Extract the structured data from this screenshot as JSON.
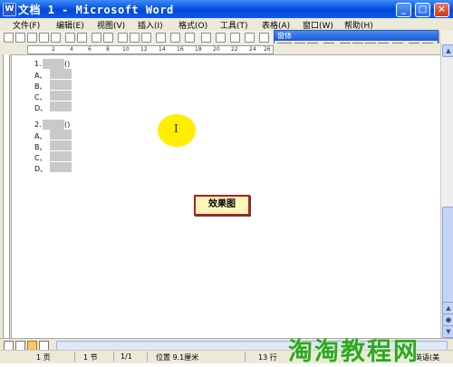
{
  "window": {
    "title": "文档 1 - Microsoft Word",
    "app_icon": "word-icon"
  },
  "menu": {
    "items": [
      "文件(F)",
      "编辑(E)",
      "视图(V)",
      "插入(I)",
      "格式(O)",
      "工具(T)",
      "表格(A)",
      "窗口(W)",
      "帮助(H)"
    ]
  },
  "forms_toolbar": {
    "title": "窗体",
    "text_field_label": "abl"
  },
  "ruler": {
    "ticks": [
      "2",
      "4",
      "6",
      "8",
      "10",
      "12",
      "14",
      "16",
      "18",
      "20",
      "22",
      "24",
      "26"
    ]
  },
  "document": {
    "questions": [
      {
        "number": "1.",
        "paren": "()",
        "options": [
          "A、",
          "B、",
          "C、",
          "D、"
        ]
      },
      {
        "number": "2.",
        "paren": "()",
        "options": [
          "A、",
          "B、",
          "C、",
          "D、"
        ]
      }
    ],
    "cursor_glyph": "I",
    "effect_label": "效果图"
  },
  "status": {
    "page": "1 页",
    "section": "1 节",
    "page_of": "1/1",
    "position": "位置 9.1厘米",
    "line": "13 行",
    "language": "英语(美"
  },
  "watermark": "淘淘教程网",
  "colors": {
    "title_bar": "#0a54e3",
    "chrome": "#ece9d8",
    "highlight": "#ffee00",
    "label_border": "#b02020",
    "watermark": "#2fa81f"
  }
}
